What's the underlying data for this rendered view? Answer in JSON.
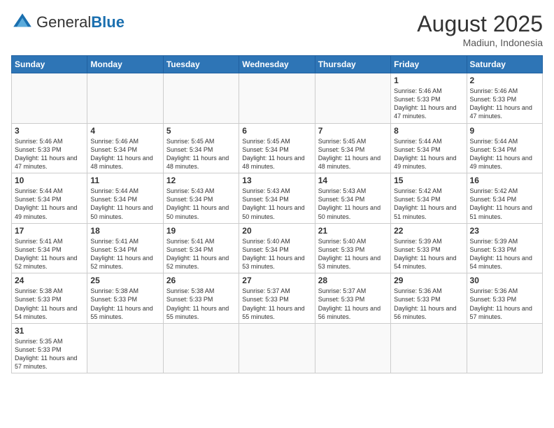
{
  "header": {
    "logo_general": "General",
    "logo_blue": "Blue",
    "month_year": "August 2025",
    "location": "Madiun, Indonesia"
  },
  "weekdays": [
    "Sunday",
    "Monday",
    "Tuesday",
    "Wednesday",
    "Thursday",
    "Friday",
    "Saturday"
  ],
  "weeks": [
    [
      {
        "day": "",
        "info": ""
      },
      {
        "day": "",
        "info": ""
      },
      {
        "day": "",
        "info": ""
      },
      {
        "day": "",
        "info": ""
      },
      {
        "day": "",
        "info": ""
      },
      {
        "day": "1",
        "info": "Sunrise: 5:46 AM\nSunset: 5:33 PM\nDaylight: 11 hours and 47 minutes."
      },
      {
        "day": "2",
        "info": "Sunrise: 5:46 AM\nSunset: 5:33 PM\nDaylight: 11 hours and 47 minutes."
      }
    ],
    [
      {
        "day": "3",
        "info": "Sunrise: 5:46 AM\nSunset: 5:33 PM\nDaylight: 11 hours and 47 minutes."
      },
      {
        "day": "4",
        "info": "Sunrise: 5:46 AM\nSunset: 5:34 PM\nDaylight: 11 hours and 48 minutes."
      },
      {
        "day": "5",
        "info": "Sunrise: 5:45 AM\nSunset: 5:34 PM\nDaylight: 11 hours and 48 minutes."
      },
      {
        "day": "6",
        "info": "Sunrise: 5:45 AM\nSunset: 5:34 PM\nDaylight: 11 hours and 48 minutes."
      },
      {
        "day": "7",
        "info": "Sunrise: 5:45 AM\nSunset: 5:34 PM\nDaylight: 11 hours and 48 minutes."
      },
      {
        "day": "8",
        "info": "Sunrise: 5:44 AM\nSunset: 5:34 PM\nDaylight: 11 hours and 49 minutes."
      },
      {
        "day": "9",
        "info": "Sunrise: 5:44 AM\nSunset: 5:34 PM\nDaylight: 11 hours and 49 minutes."
      }
    ],
    [
      {
        "day": "10",
        "info": "Sunrise: 5:44 AM\nSunset: 5:34 PM\nDaylight: 11 hours and 49 minutes."
      },
      {
        "day": "11",
        "info": "Sunrise: 5:44 AM\nSunset: 5:34 PM\nDaylight: 11 hours and 50 minutes."
      },
      {
        "day": "12",
        "info": "Sunrise: 5:43 AM\nSunset: 5:34 PM\nDaylight: 11 hours and 50 minutes."
      },
      {
        "day": "13",
        "info": "Sunrise: 5:43 AM\nSunset: 5:34 PM\nDaylight: 11 hours and 50 minutes."
      },
      {
        "day": "14",
        "info": "Sunrise: 5:43 AM\nSunset: 5:34 PM\nDaylight: 11 hours and 50 minutes."
      },
      {
        "day": "15",
        "info": "Sunrise: 5:42 AM\nSunset: 5:34 PM\nDaylight: 11 hours and 51 minutes."
      },
      {
        "day": "16",
        "info": "Sunrise: 5:42 AM\nSunset: 5:34 PM\nDaylight: 11 hours and 51 minutes."
      }
    ],
    [
      {
        "day": "17",
        "info": "Sunrise: 5:41 AM\nSunset: 5:34 PM\nDaylight: 11 hours and 52 minutes."
      },
      {
        "day": "18",
        "info": "Sunrise: 5:41 AM\nSunset: 5:34 PM\nDaylight: 11 hours and 52 minutes."
      },
      {
        "day": "19",
        "info": "Sunrise: 5:41 AM\nSunset: 5:34 PM\nDaylight: 11 hours and 52 minutes."
      },
      {
        "day": "20",
        "info": "Sunrise: 5:40 AM\nSunset: 5:34 PM\nDaylight: 11 hours and 53 minutes."
      },
      {
        "day": "21",
        "info": "Sunrise: 5:40 AM\nSunset: 5:33 PM\nDaylight: 11 hours and 53 minutes."
      },
      {
        "day": "22",
        "info": "Sunrise: 5:39 AM\nSunset: 5:33 PM\nDaylight: 11 hours and 54 minutes."
      },
      {
        "day": "23",
        "info": "Sunrise: 5:39 AM\nSunset: 5:33 PM\nDaylight: 11 hours and 54 minutes."
      }
    ],
    [
      {
        "day": "24",
        "info": "Sunrise: 5:38 AM\nSunset: 5:33 PM\nDaylight: 11 hours and 54 minutes."
      },
      {
        "day": "25",
        "info": "Sunrise: 5:38 AM\nSunset: 5:33 PM\nDaylight: 11 hours and 55 minutes."
      },
      {
        "day": "26",
        "info": "Sunrise: 5:38 AM\nSunset: 5:33 PM\nDaylight: 11 hours and 55 minutes."
      },
      {
        "day": "27",
        "info": "Sunrise: 5:37 AM\nSunset: 5:33 PM\nDaylight: 11 hours and 55 minutes."
      },
      {
        "day": "28",
        "info": "Sunrise: 5:37 AM\nSunset: 5:33 PM\nDaylight: 11 hours and 56 minutes."
      },
      {
        "day": "29",
        "info": "Sunrise: 5:36 AM\nSunset: 5:33 PM\nDaylight: 11 hours and 56 minutes."
      },
      {
        "day": "30",
        "info": "Sunrise: 5:36 AM\nSunset: 5:33 PM\nDaylight: 11 hours and 57 minutes."
      }
    ],
    [
      {
        "day": "31",
        "info": "Sunrise: 5:35 AM\nSunset: 5:33 PM\nDaylight: 11 hours and 57 minutes."
      },
      {
        "day": "",
        "info": ""
      },
      {
        "day": "",
        "info": ""
      },
      {
        "day": "",
        "info": ""
      },
      {
        "day": "",
        "info": ""
      },
      {
        "day": "",
        "info": ""
      },
      {
        "day": "",
        "info": ""
      }
    ]
  ]
}
